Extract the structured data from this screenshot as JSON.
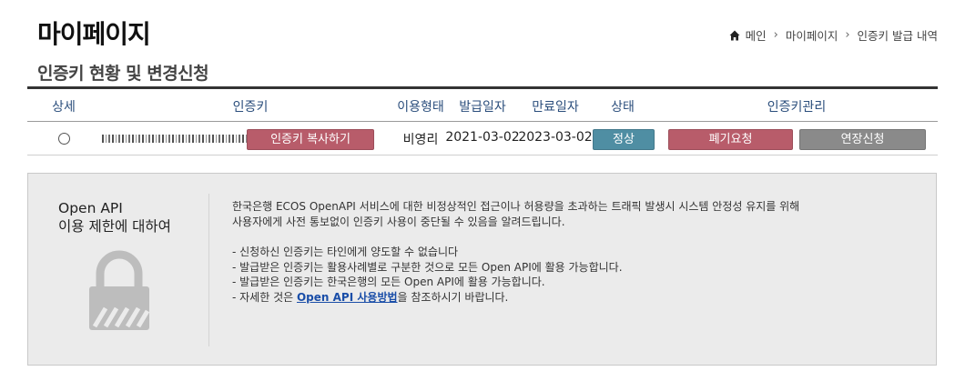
{
  "page": {
    "title": "마이페이지"
  },
  "breadcrumb": {
    "home_icon": "home-icon",
    "items": [
      "메인",
      "마이페이지",
      "인증키 발급 내역"
    ]
  },
  "section": {
    "title": "인증키 현황 및 변경신청"
  },
  "table": {
    "headers": {
      "detail": "상세",
      "key": "인증키",
      "usage": "이용형태",
      "issued": "발급일자",
      "expiry": "만료일자",
      "status": "상태",
      "manage": "인증키관리"
    },
    "row": {
      "usage": "비영리",
      "issued": "2021-03-02",
      "expiry": "2023-03-02",
      "copy_label": "인증키 복사하기",
      "status_label": "정상",
      "discard_label": "폐기요청",
      "extend_label": "연장신청"
    },
    "colors": {
      "copy": "#b85c6a",
      "status": "#4f8ea3",
      "discard": "#b85c6a",
      "extend": "#8a8a8a"
    }
  },
  "notice": {
    "title_line1": "Open API",
    "title_line2": "이용 제한에 대하여",
    "icon": "lock-icon",
    "para1_line1": "한국은행 ECOS OpenAPI 서비스에 대한 비정상적인 접근이나 허용량을 초과하는 트래픽 발생시 시스템 안정성 유지를 위해",
    "para1_line2": "사용자에게 사전 통보없이 인증키 사용이 중단될 수 있음을 알려드립니다.",
    "bullet1": "- 신청하신 인증키는 타인에게 양도할 수 없습니다",
    "bullet2": "- 발급받은 인증키는 활용사례별로 구분한 것으로 모든 Open API에 활용 가능합니다.",
    "bullet3": "- 발급받은 인증키는 한국은행의 모든 Open API에 활용 가능합니다.",
    "bullet4_prefix": "- 자세한 것은 ",
    "bullet4_link": "Open API 사용방법",
    "bullet4_suffix": "을 참조하시기 바랍니다."
  }
}
